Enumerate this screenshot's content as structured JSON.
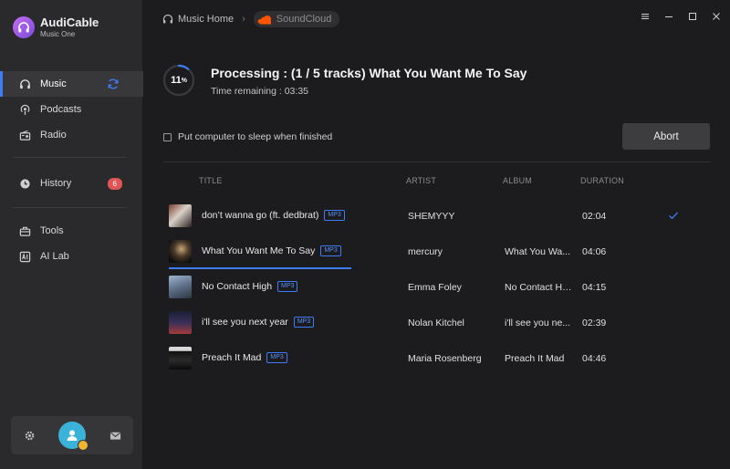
{
  "app": {
    "name": "AudiCable",
    "subtitle": "Music One"
  },
  "sidebar": {
    "items": [
      {
        "label": "Music",
        "icon": "headphones-icon",
        "active": true
      },
      {
        "label": "Podcasts",
        "icon": "podcast-icon"
      },
      {
        "label": "Radio",
        "icon": "radio-icon"
      },
      {
        "label": "History",
        "icon": "clock-icon",
        "badge": "6"
      },
      {
        "label": "Tools",
        "icon": "toolbox-icon"
      },
      {
        "label": "AI Lab",
        "icon": "ai-icon"
      }
    ]
  },
  "breadcrumb": {
    "home": "Music Home",
    "source": "SoundCloud"
  },
  "processing": {
    "percent": "11",
    "percent_sign": "%",
    "progress_fraction": 0.11,
    "title": "Processing : (1 / 5 tracks) What You Want Me To Say",
    "time_remaining": "Time remaining :  03:35"
  },
  "sleep_option": "Put computer to sleep when finished",
  "abort_label": "Abort",
  "table": {
    "headers": {
      "title": "TITLE",
      "artist": "ARTIST",
      "album": "ALBUM",
      "duration": "DURATION"
    },
    "format_tag": "MP3",
    "rows": [
      {
        "title": "don’t wanna go (ft. dedbrat)",
        "artist": "SHEMYYY",
        "album": "",
        "duration": "02:04",
        "done": true
      },
      {
        "title": "What You Want Me To Say",
        "artist": "mercury",
        "album": "What You Wa...",
        "duration": "04:06",
        "converting": true
      },
      {
        "title": "No Contact High",
        "artist": "Emma Foley",
        "album": "No Contact High",
        "duration": "04:15"
      },
      {
        "title": "i'll see you next year",
        "artist": "Nolan Kitchel",
        "album": "i'll see you ne...",
        "duration": "02:39"
      },
      {
        "title": "Preach It Mad",
        "artist": "Maria Rosenberg",
        "album": "Preach It Mad",
        "duration": "04:46"
      }
    ]
  },
  "colors": {
    "accent": "#3d7bf7",
    "badge": "#e05555",
    "soundcloud": "#ff5500"
  }
}
